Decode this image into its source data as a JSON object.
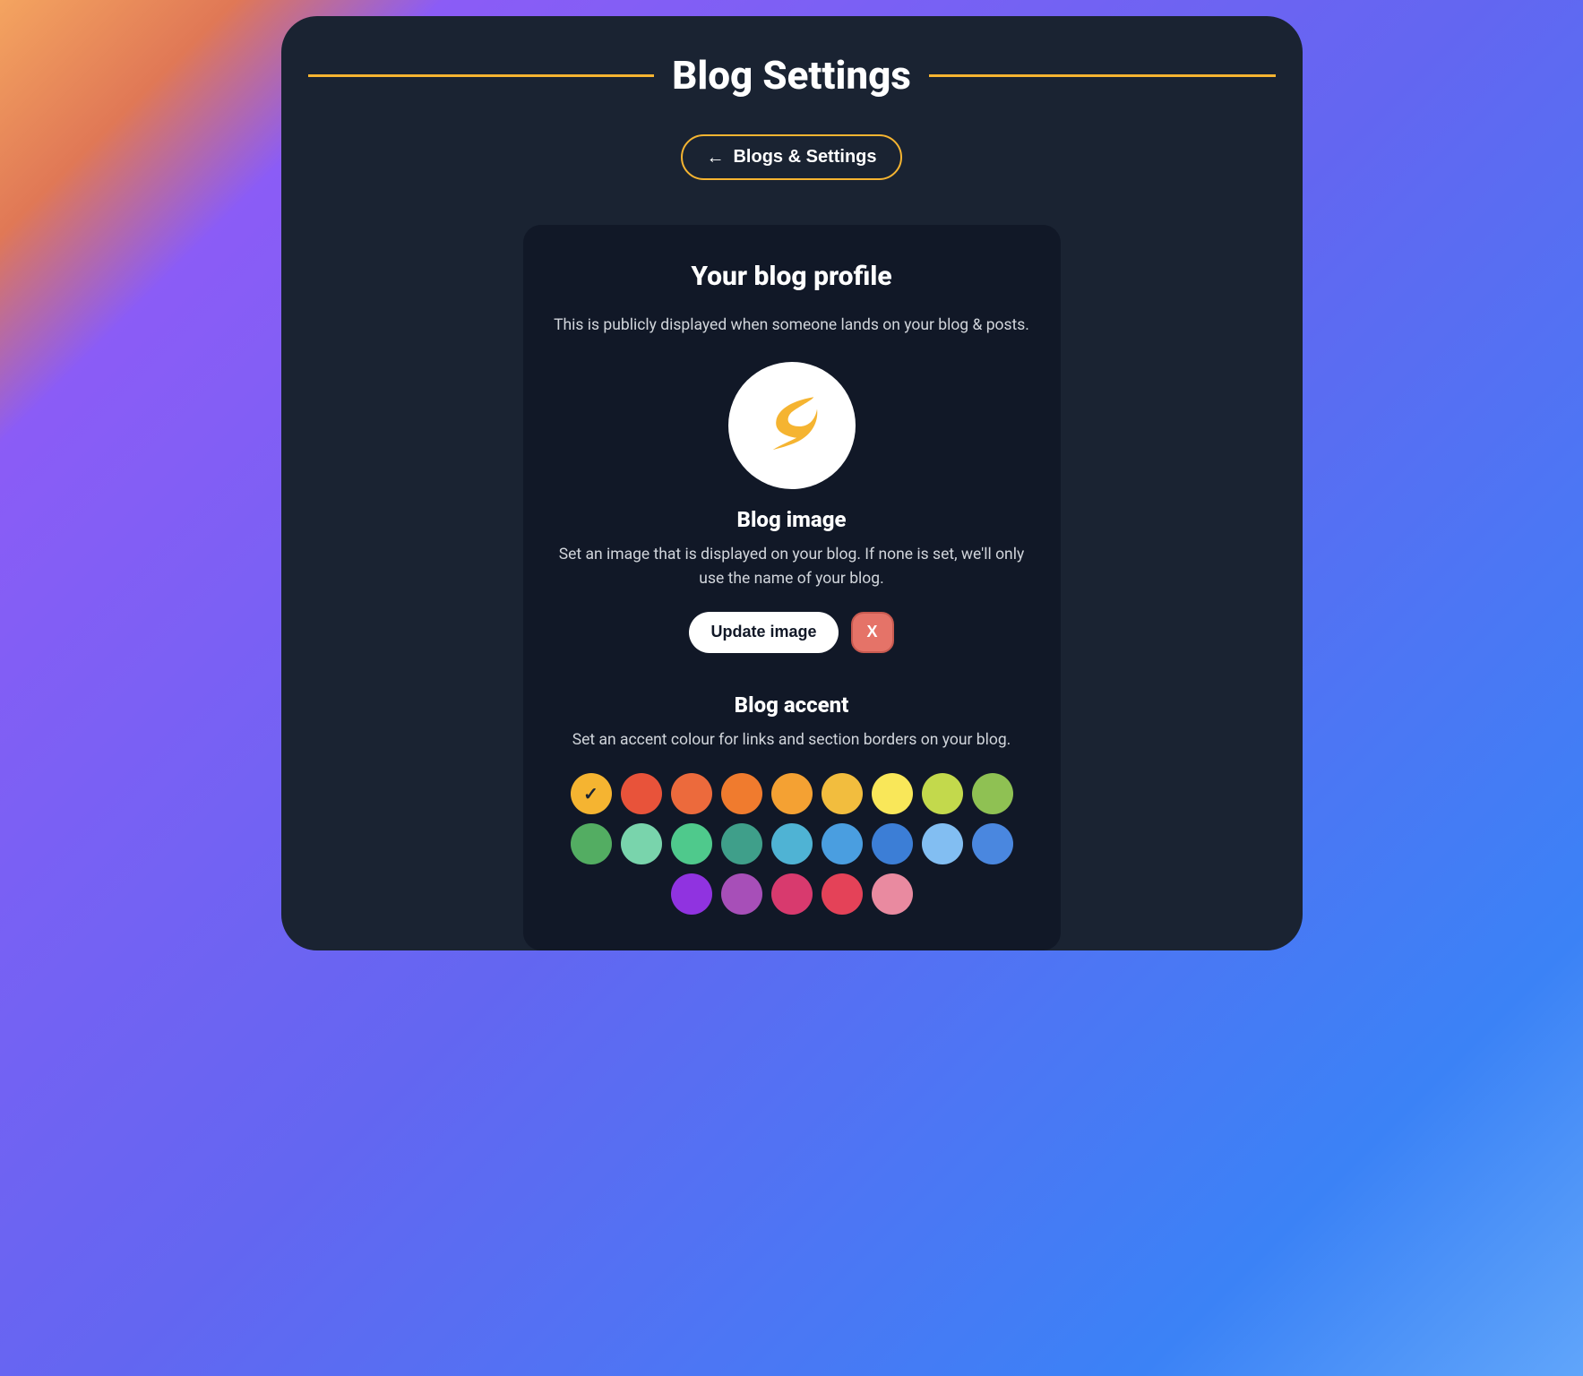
{
  "header": {
    "title": "Blog Settings",
    "back_label": "Blogs & Settings"
  },
  "profile": {
    "heading": "Your blog profile",
    "description": "This is publicly displayed when someone lands on your blog & posts."
  },
  "image_section": {
    "heading": "Blog image",
    "description": "Set an image that is displayed on your blog. If none is set, we'll only use the name of your blog.",
    "update_label": "Update image",
    "delete_label": "X"
  },
  "accent_section": {
    "heading": "Blog accent",
    "description": "Set an accent colour for links and section borders on your blog.",
    "selected_index": 0,
    "colors": [
      "#f5b431",
      "#e8533a",
      "#ec6a3c",
      "#f07b2e",
      "#f4a133",
      "#f2bd3e",
      "#f9e759",
      "#c3d94c",
      "#8fc153",
      "#53ad62",
      "#79d4ac",
      "#4fc98c",
      "#3f9f8a",
      "#4fb3d4",
      "#4a9ee0",
      "#3c7ed6",
      "#82bef2",
      "#4a87df",
      "#9033e0",
      "#a74fb8",
      "#d83a6e",
      "#e44258",
      "#e98aa0"
    ]
  },
  "colors": {
    "accent": "#f5b431"
  }
}
